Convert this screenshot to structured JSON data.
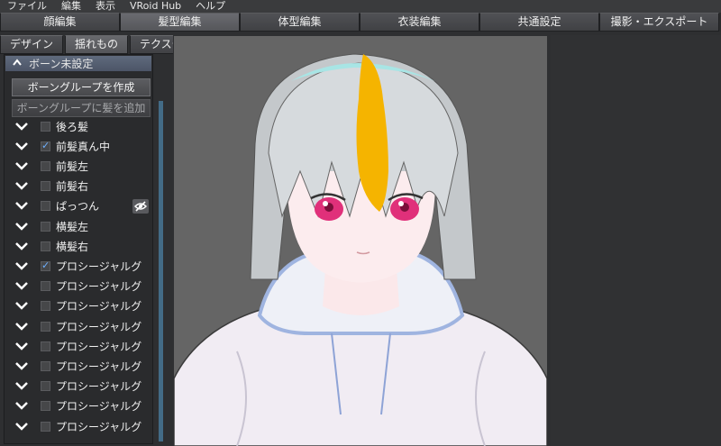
{
  "menu": [
    "ファイル",
    "編集",
    "表示",
    "VRoid Hub",
    "ヘルプ"
  ],
  "main_tabs": [
    {
      "label": "顔編集",
      "active": false
    },
    {
      "label": "髪型編集",
      "active": true
    },
    {
      "label": "体型編集",
      "active": false
    },
    {
      "label": "衣装編集",
      "active": false
    },
    {
      "label": "共通設定",
      "active": false
    },
    {
      "label": "撮影・エクスポート",
      "active": false
    }
  ],
  "sub_tabs": [
    {
      "label": "デザイン",
      "active": false
    },
    {
      "label": "揺れもの",
      "active": true
    },
    {
      "label": "テクスチャ",
      "active": false
    }
  ],
  "section": {
    "title": "ボーン未設定",
    "caret": "^"
  },
  "buttons": {
    "create_group": "ボーングループを作成",
    "add_hair": "ボーングループに髪を追加"
  },
  "hair_items": [
    {
      "label": "後ろ髪",
      "checked": false
    },
    {
      "label": "前髪真ん中",
      "checked": true
    },
    {
      "label": "前髪左",
      "checked": false
    },
    {
      "label": "前髪右",
      "checked": false
    },
    {
      "label": "ぱっつん",
      "checked": false,
      "hidden": true
    },
    {
      "label": "横髪左",
      "checked": false
    },
    {
      "label": "横髪右",
      "checked": false
    },
    {
      "label": "プロシージャルグ",
      "checked": true
    },
    {
      "label": "プロシージャルグ",
      "checked": false
    },
    {
      "label": "プロシージャルグ",
      "checked": false
    },
    {
      "label": "プロシージャルグ",
      "checked": false
    },
    {
      "label": "プロシージャルグ",
      "checked": false
    },
    {
      "label": "プロシージャルグ",
      "checked": false
    },
    {
      "label": "プロシージャルグ",
      "checked": false
    },
    {
      "label": "プロシージャルグ",
      "checked": false
    },
    {
      "label": "プロシージャルグ",
      "checked": false
    }
  ],
  "colors": {
    "selected_hair": "#f5b400",
    "hair": "#cfd3d6",
    "eye": "#e0307a",
    "hoodie": "#f3eef5",
    "hoodie_trim": "#9fb4e0",
    "viewport_bg": "#656565",
    "section_header": "#55607a",
    "scrollbar": "#436b86"
  }
}
